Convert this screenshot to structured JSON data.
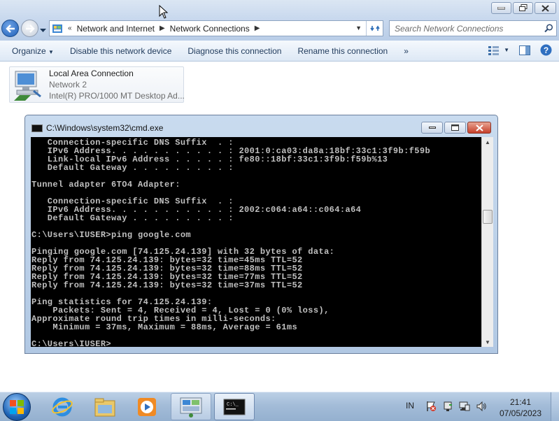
{
  "explorer": {
    "breadcrumbs": [
      "Network and Internet",
      "Network Connections"
    ],
    "search_placeholder": "Search Network Connections",
    "toolbar": {
      "organize": "Organize",
      "disable": "Disable this network device",
      "diagnose": "Diagnose this connection",
      "rename": "Rename this connection",
      "more": "»"
    },
    "adapter": {
      "name": "Local Area Connection",
      "network": "Network  2",
      "device": "Intel(R) PRO/1000 MT Desktop Ad..."
    }
  },
  "cmd": {
    "title": "C:\\Windows\\system32\\cmd.exe",
    "lines": [
      "   Connection-specific DNS Suffix  . :",
      "   IPv6 Address. . . . . . . . . . . : 2001:0:ca03:da8a:18bf:33c1:3f9b:f59b",
      "   Link-local IPv6 Address . . . . . : fe80::18bf:33c1:3f9b:f59b%13",
      "   Default Gateway . . . . . . . . . :",
      "",
      "Tunnel adapter 6TO4 Adapter:",
      "",
      "   Connection-specific DNS Suffix  . :",
      "   IPv6 Address. . . . . . . . . . . : 2002:c064:a64::c064:a64",
      "   Default Gateway . . . . . . . . . :",
      "",
      "C:\\Users\\IUSER>ping google.com",
      "",
      "Pinging google.com [74.125.24.139] with 32 bytes of data:",
      "Reply from 74.125.24.139: bytes=32 time=45ms TTL=52",
      "Reply from 74.125.24.139: bytes=32 time=88ms TTL=52",
      "Reply from 74.125.24.139: bytes=32 time=77ms TTL=52",
      "Reply from 74.125.24.139: bytes=32 time=37ms TTL=52",
      "",
      "Ping statistics for 74.125.24.139:",
      "    Packets: Sent = 4, Received = 4, Lost = 0 (0% loss),",
      "Approximate round trip times in milli-seconds:",
      "    Minimum = 37ms, Maximum = 88ms, Average = 61ms",
      "",
      "C:\\Users\\IUSER>"
    ]
  },
  "taskbar": {
    "language": "IN",
    "time": "21:41",
    "date": "07/05/2023"
  }
}
